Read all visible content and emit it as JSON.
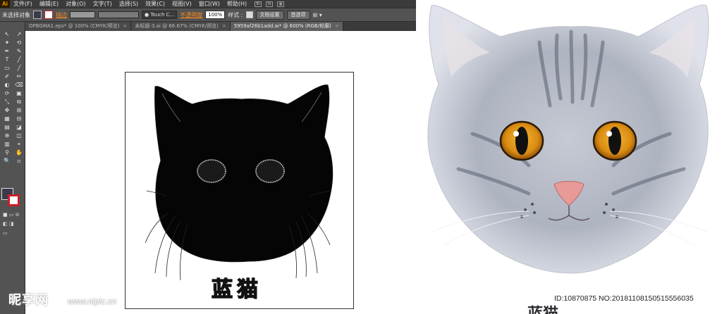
{
  "app": {
    "logo": "Ai",
    "menu": [
      "文件(F)",
      "编辑(E)",
      "对象(O)",
      "文字(T)",
      "选择(S)",
      "效果(C)",
      "视图(V)",
      "窗口(W)",
      "帮助(H)"
    ],
    "menu_icons": [
      "Br",
      "St"
    ]
  },
  "control_bar": {
    "selection": "未选择对象",
    "stroke_label": "描边",
    "font_field": "Touch C...",
    "opacity_label": "不透明度",
    "opacity_value": "100%",
    "style_label": "样式 :",
    "doc_setup_button": "文档设置",
    "preferences_button": "首选项"
  },
  "tabs": [
    {
      "label": "OPBGMA1.eps* @ 100% (CMYK/预览)",
      "active": false
    },
    {
      "label": "未标题-3.ai @ 66.67% (CMYK/预览)",
      "active": false
    },
    {
      "label": "5959af26b1add.ai* @ 600% (RGB/轮廓)",
      "active": true
    }
  ],
  "tools": [
    "↖",
    "↗",
    "✦",
    "⟲",
    "✒",
    "✎",
    "T",
    "╱",
    "▭",
    "╱",
    "✐",
    "✏",
    "◐",
    "⌫",
    "⟳",
    "▣",
    "⤡",
    "⧉",
    "✥",
    "⊞",
    "▦",
    "⊟",
    "▤",
    "◪",
    "⊕",
    "◫",
    "▥",
    "⌖",
    "⚲",
    "✋",
    "🔍",
    "▫"
  ],
  "artboard": {
    "caption_glyphs": [
      "蓝",
      "猫"
    ]
  },
  "colors": {
    "accent_orange": "#ff8c1a",
    "stroke_red": "#c8202a",
    "ui_dark": "#535353",
    "cat_eye": "#d98c12",
    "cat_nose": "#e89a98"
  },
  "watermark": {
    "logo": "昵享网",
    "url": "www.nipic.cn",
    "id_text": "ID:10870875 NO:20181108150515556035"
  },
  "photo_caption": "蓝猫"
}
